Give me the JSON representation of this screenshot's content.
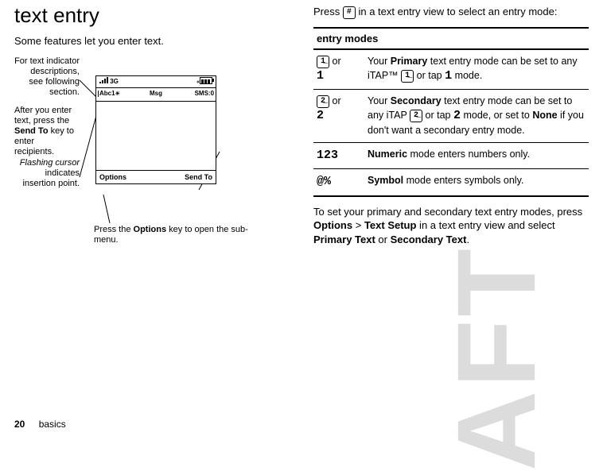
{
  "page_number": "20",
  "footer_section": "basics",
  "left": {
    "heading": "text entry",
    "intro": "Some features let you enter text.",
    "callouts": {
      "indicators_1": "For text indicator descriptions, see following section.",
      "cursor_em": "Flashing cursor",
      "cursor_rest": " indicates insertion point.",
      "bottom_pre": "Press the ",
      "bottom_b": "Options",
      "bottom_post": " key to open the sub-menu.",
      "right_1": "After you enter text, press the ",
      "right_b": "Send To",
      "right_2": " key to enter recipients."
    },
    "phone": {
      "status_left": "3G",
      "header_left": "Abc1",
      "header_mid": "Msg",
      "header_right": "SMS:0",
      "soft_left": "Options",
      "soft_right": "Send To"
    }
  },
  "right": {
    "intro_pre": "Press ",
    "intro_key": "#",
    "intro_post": " in a text entry view to select an entry mode:",
    "table_header": "entry modes",
    "rows": [
      {
        "sym1": "1̲",
        "conj": " or ",
        "sym2": "1",
        "text_pre": "Your ",
        "text_b1": "Primary",
        "text_mid": " text entry mode can be set to any iTAP™ ",
        "text_key1": "1̲",
        "text_mid2": " or tap ",
        "text_key2": "1",
        "text_post": " mode."
      },
      {
        "sym1": "2̲",
        "conj": " or ",
        "sym2": "2",
        "text_pre": "Your ",
        "text_b1": "Secondary",
        "text_mid": " text entry mode can be set to any iTAP ",
        "text_key1": "2̲",
        "text_mid2": " or tap ",
        "text_key2": "2",
        "text_mid3": " mode, or set to ",
        "text_b2": "None",
        "text_post": " if you don't want a secondary entry mode."
      },
      {
        "sym_plain": "123",
        "text_b1": "Numeric",
        "text_post": " mode enters numbers only."
      },
      {
        "sym_plain": "@%",
        "text_b1": "Symbol",
        "text_post": " mode enters symbols only."
      }
    ],
    "outro_1": "To set your primary and secondary text entry modes, press ",
    "outro_b1": "Options",
    "outro_gt": " > ",
    "outro_b2": "Text Setup",
    "outro_2": " in a text entry view and select ",
    "outro_b3": "Primary Text",
    "outro_or": " or ",
    "outro_b4": "Secondary Text",
    "outro_end": "."
  }
}
